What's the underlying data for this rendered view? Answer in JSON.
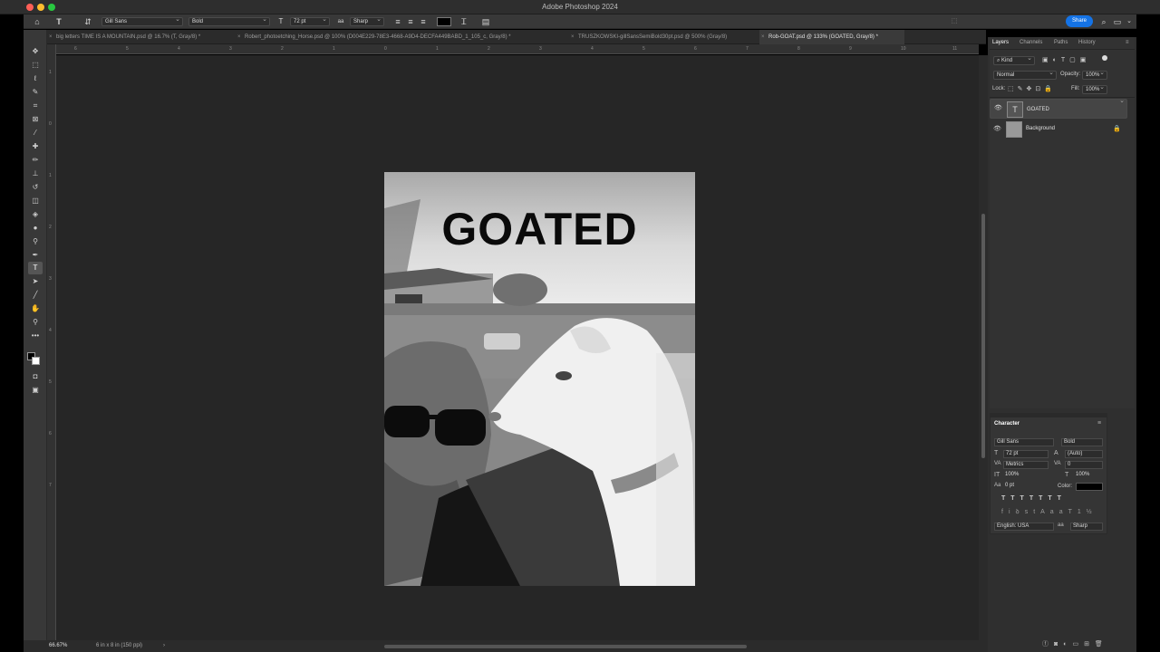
{
  "app": {
    "title": "Adobe Photoshop 2024"
  },
  "colors": {
    "accent": "#1473e6",
    "workspace": "#262626",
    "panel": "#323232",
    "selected_layer": "#454545"
  },
  "options_bar": {
    "font_family": "Gill Sans",
    "font_style": "Bold",
    "font_size": "72 pt",
    "anti_alias": "Sharp",
    "text_color": "#000000",
    "share_label": "Share"
  },
  "tabs": [
    {
      "label": "big letters TIME IS A MOUNTAIN.psd @ 16.7% (T, Gray/8) *",
      "active": false
    },
    {
      "label": "Robert_photoetching_Horse.psd @ 100% (D004E229-78E3-4668-A9D4-DECFA449BABD_1_105_c, Gray/8) *",
      "active": false
    },
    {
      "label": "TRUSZKOWSKI-gillSansSemiBold30pt.psd @ 500% (Gray/8)",
      "active": false
    },
    {
      "label": "Rob-GOAT.psd @ 133% (GOATED, Gray/8) *",
      "active": true
    }
  ],
  "ruler_h": [
    "6",
    "5",
    "4",
    "3",
    "2",
    "1",
    "0",
    "1",
    "2",
    "3",
    "4",
    "5",
    "6",
    "7",
    "8",
    "9",
    "10",
    "11"
  ],
  "ruler_v": [
    "1",
    "0",
    "1",
    "2",
    "3",
    "4",
    "5",
    "6",
    "7"
  ],
  "canvas": {
    "headline": "GOATED"
  },
  "status": {
    "zoom": "66.67%",
    "doc_info": "6 in x 8 in (150 ppi)"
  },
  "layers_panel": {
    "tabs": [
      "Layers",
      "Channels",
      "Paths",
      "History"
    ],
    "filter": "Kind",
    "blend_mode": "Normal",
    "opacity_label": "Opacity:",
    "opacity": "100%",
    "lock_label": "Lock:",
    "fill_label": "Fill:",
    "fill": "100%",
    "layers": [
      {
        "name": "GOATED",
        "type": "text",
        "selected": true
      },
      {
        "name": "Background",
        "type": "image",
        "selected": false,
        "locked": true
      }
    ]
  },
  "character_panel": {
    "title": "Character",
    "font_family": "Gill Sans",
    "font_style": "Bold",
    "size": "72 pt",
    "leading": "(Auto)",
    "kerning": "Metrics",
    "tracking": "0",
    "vscale": "100%",
    "hscale": "100%",
    "baseline": "0 pt",
    "color_label": "Color:",
    "language": "English: USA",
    "anti_alias": "Sharp"
  }
}
